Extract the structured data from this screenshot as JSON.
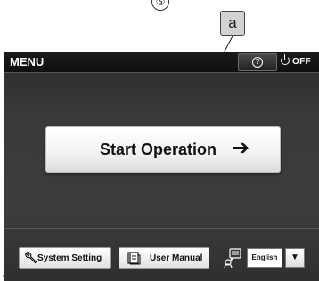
{
  "annotations": {
    "step_number": "⑤",
    "callout_label": "a"
  },
  "header": {
    "title": "MENU",
    "help_icon_glyph": "?",
    "power_label": "OFF"
  },
  "main": {
    "start_button_label": "Start Operation",
    "start_button_arrow": "➔"
  },
  "footer": {
    "system_setting_label": "System Setting",
    "user_manual_label": "User Manual",
    "language_value": "English",
    "language_dropdown_glyph": "▼"
  },
  "icons": {
    "help": "question-mark-circle",
    "power": "power-symbol",
    "system_setting": "wrench",
    "user_manual": "book",
    "language": "language-speech-bubble"
  },
  "colors": {
    "screen_bg": "#3a3a3a",
    "topbar_bg": "#141414",
    "button_face": "#f4f4f4",
    "callout_bg": "#d2d2d2"
  }
}
